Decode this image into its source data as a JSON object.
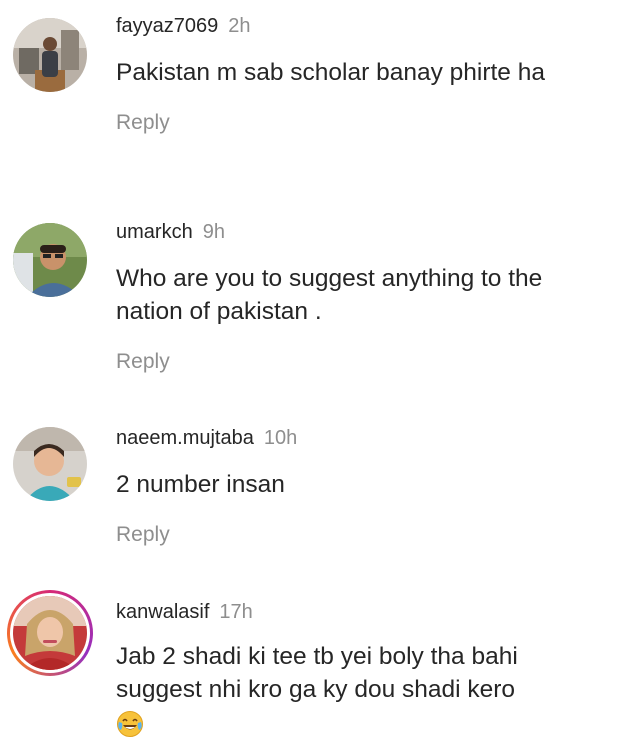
{
  "comments": [
    {
      "username": "fayyaz7069",
      "time": "2h",
      "text": "Pakistan m sab scholar banay phirte ha",
      "reply": "Reply"
    },
    {
      "username": "umarkch",
      "time": "9h",
      "text": "Who are you to suggest anything to the nation of pakistan .",
      "reply": "Reply"
    },
    {
      "username": "naeem.mujtaba",
      "time": "10h",
      "text": "2 number insan",
      "reply": "Reply"
    },
    {
      "username": "kanwalasif",
      "time": "17h",
      "text": "Jab 2 shadi ki tee tb yei boly tha  bahi suggest nhi kro ga ky dou shadi kero",
      "emoji": "face-with-tears-of-joy-icon"
    }
  ],
  "colors": {
    "text": "#262626",
    "secondary": "#8e8e8e",
    "story_ring": "#d62976"
  }
}
